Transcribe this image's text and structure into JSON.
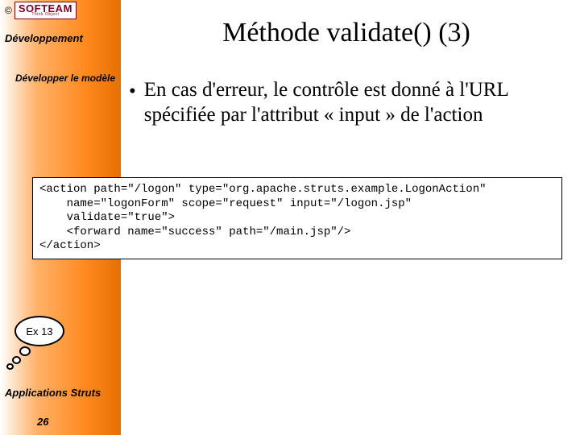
{
  "logo": {
    "copyright": "©",
    "main": "SOFTEAM",
    "sub": "Think Object"
  },
  "sidebar": {
    "heading": "Développement",
    "subheading": "Développer le modèle"
  },
  "title": "Méthode validate() (3)",
  "bullet": {
    "dot": "•",
    "text": "En cas d'erreur, le contrôle est donné à l'URL spécifiée par l'attribut « input » de l'action"
  },
  "code": "<action path=\"/logon\" type=\"org.apache.struts.example.LogonAction\"\n    name=\"logonForm\" scope=\"request\" input=\"/logon.jsp\"\n    validate=\"true\">\n    <forward name=\"success\" path=\"/main.jsp\"/>\n</action>",
  "bubble": "Ex 13",
  "footer": "Applications Struts",
  "page": "26"
}
